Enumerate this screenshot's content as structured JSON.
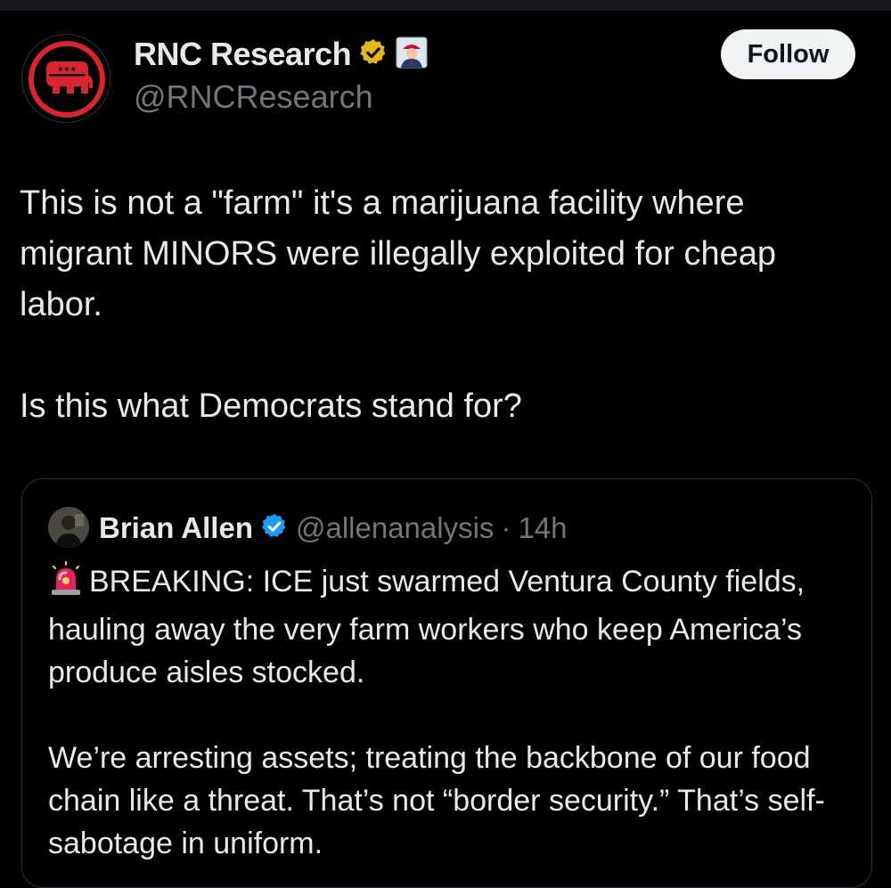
{
  "colors": {
    "background": "#000000",
    "text_primary": "#e7e9ea",
    "text_secondary": "#71767b",
    "border": "#2f3336",
    "follow_bg": "#eff3f4",
    "verified_gold": "#e2b719",
    "verified_blue": "#1d9bf0",
    "rnc_red": "#d7262f"
  },
  "post": {
    "author": {
      "name": "RNC Research",
      "handle": "@RNCResearch",
      "avatar_icon": "gop-elephant-logo",
      "badges": [
        "verified-gold-badge-icon",
        "affiliate-badge-icon"
      ]
    },
    "follow_label": "Follow",
    "text": {
      "paragraph1": "This is not a \"farm\" it's a marijuana facility where migrant MINORS were illegally exploited for cheap labor.",
      "paragraph2": "Is this what Democrats stand for?"
    }
  },
  "quoted_post": {
    "author": {
      "name": "Brian Allen",
      "handle": "@allenanalysis",
      "badge": "verified-blue-badge-icon"
    },
    "separator": "·",
    "time": "14h",
    "leading_icon": "siren-icon",
    "text": {
      "paragraph1": "BREAKING: ICE just swarmed Ventura County fields, hauling away the very farm workers who keep America’s produce aisles stocked.",
      "paragraph2": "We’re arresting assets; treating the backbone of our food chain like a threat. That’s not “border security.” That’s self-sabotage in uniform."
    }
  }
}
